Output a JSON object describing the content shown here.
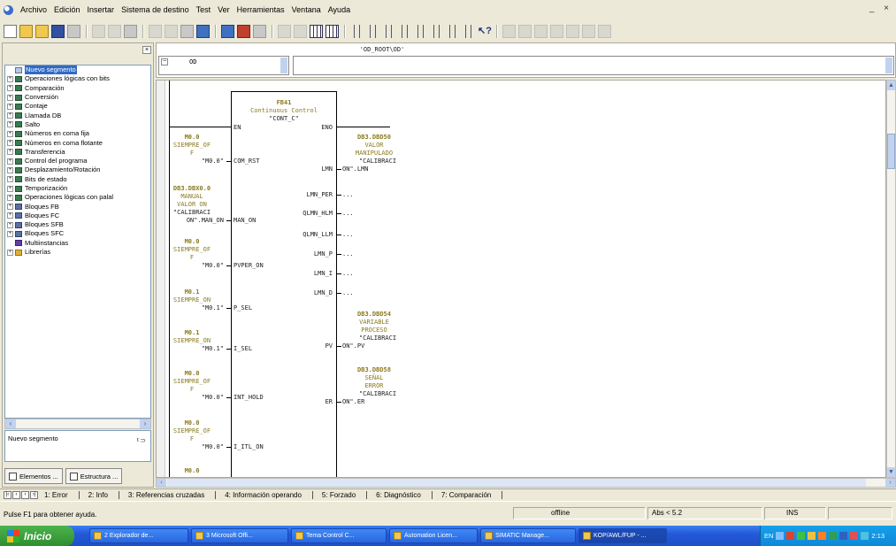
{
  "menu": {
    "items": [
      "Archivo",
      "Edición",
      "Insertar",
      "Sistema de destino",
      "Test",
      "Ver",
      "Herramientas",
      "Ventana",
      "Ayuda"
    ],
    "window_controls": "_ ×"
  },
  "toolbar": {
    "help_glyph": "↖?"
  },
  "catalog": {
    "tree": [
      {
        "label": "Nuevo segmento",
        "icon": "segment-icon",
        "selected": true,
        "expandable": false
      },
      {
        "label": "Operaciones lógicas con bits",
        "icon": "bit-logic-icon",
        "expandable": true
      },
      {
        "label": "Comparación",
        "icon": "compare-icon",
        "expandable": true
      },
      {
        "label": "Conversión",
        "icon": "convert-icon",
        "expandable": true
      },
      {
        "label": "Contaje",
        "icon": "counter-icon",
        "expandable": true
      },
      {
        "label": "Llamada DB",
        "icon": "db-call-icon",
        "expandable": true
      },
      {
        "label": "Salto",
        "icon": "jump-icon",
        "expandable": true
      },
      {
        "label": "Números en coma fija",
        "icon": "fixed-point-icon",
        "expandable": true
      },
      {
        "label": "Números en coma flotante",
        "icon": "floating-point-icon",
        "expandable": true
      },
      {
        "label": "Transferencia",
        "icon": "move-icon",
        "expandable": true
      },
      {
        "label": "Control del programa",
        "icon": "program-control-icon",
        "expandable": true
      },
      {
        "label": "Desplazamiento/Rotación",
        "icon": "shift-rotate-icon",
        "expandable": true
      },
      {
        "label": "Bits de estado",
        "icon": "status-bits-icon",
        "expandable": true
      },
      {
        "label": "Temporización",
        "icon": "timer-icon",
        "expandable": true
      },
      {
        "label": "Operaciones lógicas con palal",
        "icon": "word-logic-icon",
        "expandable": true
      },
      {
        "label": "Bloques FB",
        "icon": "fb-block-icon",
        "expandable": true
      },
      {
        "label": "Bloques FC",
        "icon": "fc-block-icon",
        "expandable": true
      },
      {
        "label": "Bloques SFB",
        "icon": "sfb-block-icon",
        "expandable": true
      },
      {
        "label": "Bloques SFC",
        "icon": "sfc-block-icon",
        "expandable": true
      },
      {
        "label": "Multiinstancias",
        "icon": "multiinstance-icon",
        "expandable": false
      },
      {
        "label": "Librerías",
        "icon": "library-icon",
        "expandable": true
      }
    ],
    "info_text": "Nuevo segmento",
    "tabs": [
      "Elementos ...",
      "Estructura ..."
    ]
  },
  "declaration": {
    "path": "'OD_ROOT\\OD'",
    "left_value": "OD"
  },
  "fb": {
    "name": "FB41",
    "title": "Continuous Control",
    "instance": "\"CONT_C\"",
    "en": "EN",
    "eno": "ENO"
  },
  "inputs": [
    {
      "addr": "M0.0",
      "sym1": "SIEMPRE_OF",
      "sym2": "F",
      "val": "\"M0.0\"",
      "pin": "COM_RST"
    },
    {
      "addr": "DB3.DBX0.0",
      "sym1": "MANUAL",
      "sym2": "VALOR ON",
      "sym3": "\"CALIBRACI",
      "val": "ON\".MAN_ON",
      "pin": "MAN_ON"
    },
    {
      "addr": "M0.0",
      "sym1": "SIEMPRE_OF",
      "sym2": "F",
      "val": "\"M0.0\"",
      "pin": "PVPER_ON"
    },
    {
      "addr": "M0.1",
      "sym1": "SIEMPRE_ON",
      "val": "\"M0.1\"",
      "pin": "P_SEL"
    },
    {
      "addr": "M0.1",
      "sym1": "SIEMPRE_ON",
      "val": "\"M0.1\"",
      "pin": "I_SEL"
    },
    {
      "addr": "M0.0",
      "sym1": "SIEMPRE_OF",
      "sym2": "F",
      "val": "\"M0.0\"",
      "pin": "INT_HOLD"
    },
    {
      "addr": "M0.0",
      "sym1": "SIEMPRE_OF",
      "sym2": "F",
      "val": "\"M0.0\"",
      "pin": "I_ITL_ON"
    },
    {
      "addr": "M0.0"
    }
  ],
  "outputs": [
    {
      "addr": "DB3.DBD50",
      "sym1": "VALOR",
      "sym2": "MANIPULADO",
      "sym3": "\"CALIBRACI",
      "pin": "LMN",
      "val": "ON\".LMN"
    },
    {
      "pin": "LMN_PER",
      "val": "..."
    },
    {
      "pin": "QLMN_HLM",
      "val": "..."
    },
    {
      "pin": "QLMN_LLM",
      "val": "..."
    },
    {
      "pin": "LMN_P",
      "val": "..."
    },
    {
      "pin": "LMN_I",
      "val": "..."
    },
    {
      "pin": "LMN_D",
      "val": "..."
    },
    {
      "addr": "DB3.DBD54",
      "sym1": "VARIABLE",
      "sym2": "PROCESO",
      "sym3": "\"CALIBRACI",
      "pin": "PV",
      "val": "ON\".PV"
    },
    {
      "addr": "DB3.DBD58",
      "sym1": "SEÑAL",
      "sym2": "ERROR",
      "sym3": "\"CALIBRACI",
      "pin": "ER",
      "val": "ON\".ER"
    }
  ],
  "output_tabs": [
    "1: Error",
    "2: Info",
    "3: Referencias cruzadas",
    "4: Información operando",
    "5: Forzado",
    "6: Diagnóstico",
    "7: Comparación"
  ],
  "status": {
    "help": "Pulse F1 para obtener ayuda.",
    "mode": "offline",
    "abs": "Abs < 5.2",
    "ins": "INS"
  },
  "taskbar": {
    "start": "Inicio",
    "buttons": [
      "2 Explorador de...",
      "3 Microsoft Offi...",
      "Tema Control C...",
      "Automation Licen...",
      "SIMATIC Manage...",
      "KOP/AWL/FUP - ..."
    ],
    "lang": "EN",
    "clock": "2:13"
  },
  "colors": {
    "symbol_olive": "#8b7a1e",
    "selection_blue": "#316ac5",
    "taskbar_blue": "#2459d8",
    "start_green": "#3a9e3a"
  }
}
